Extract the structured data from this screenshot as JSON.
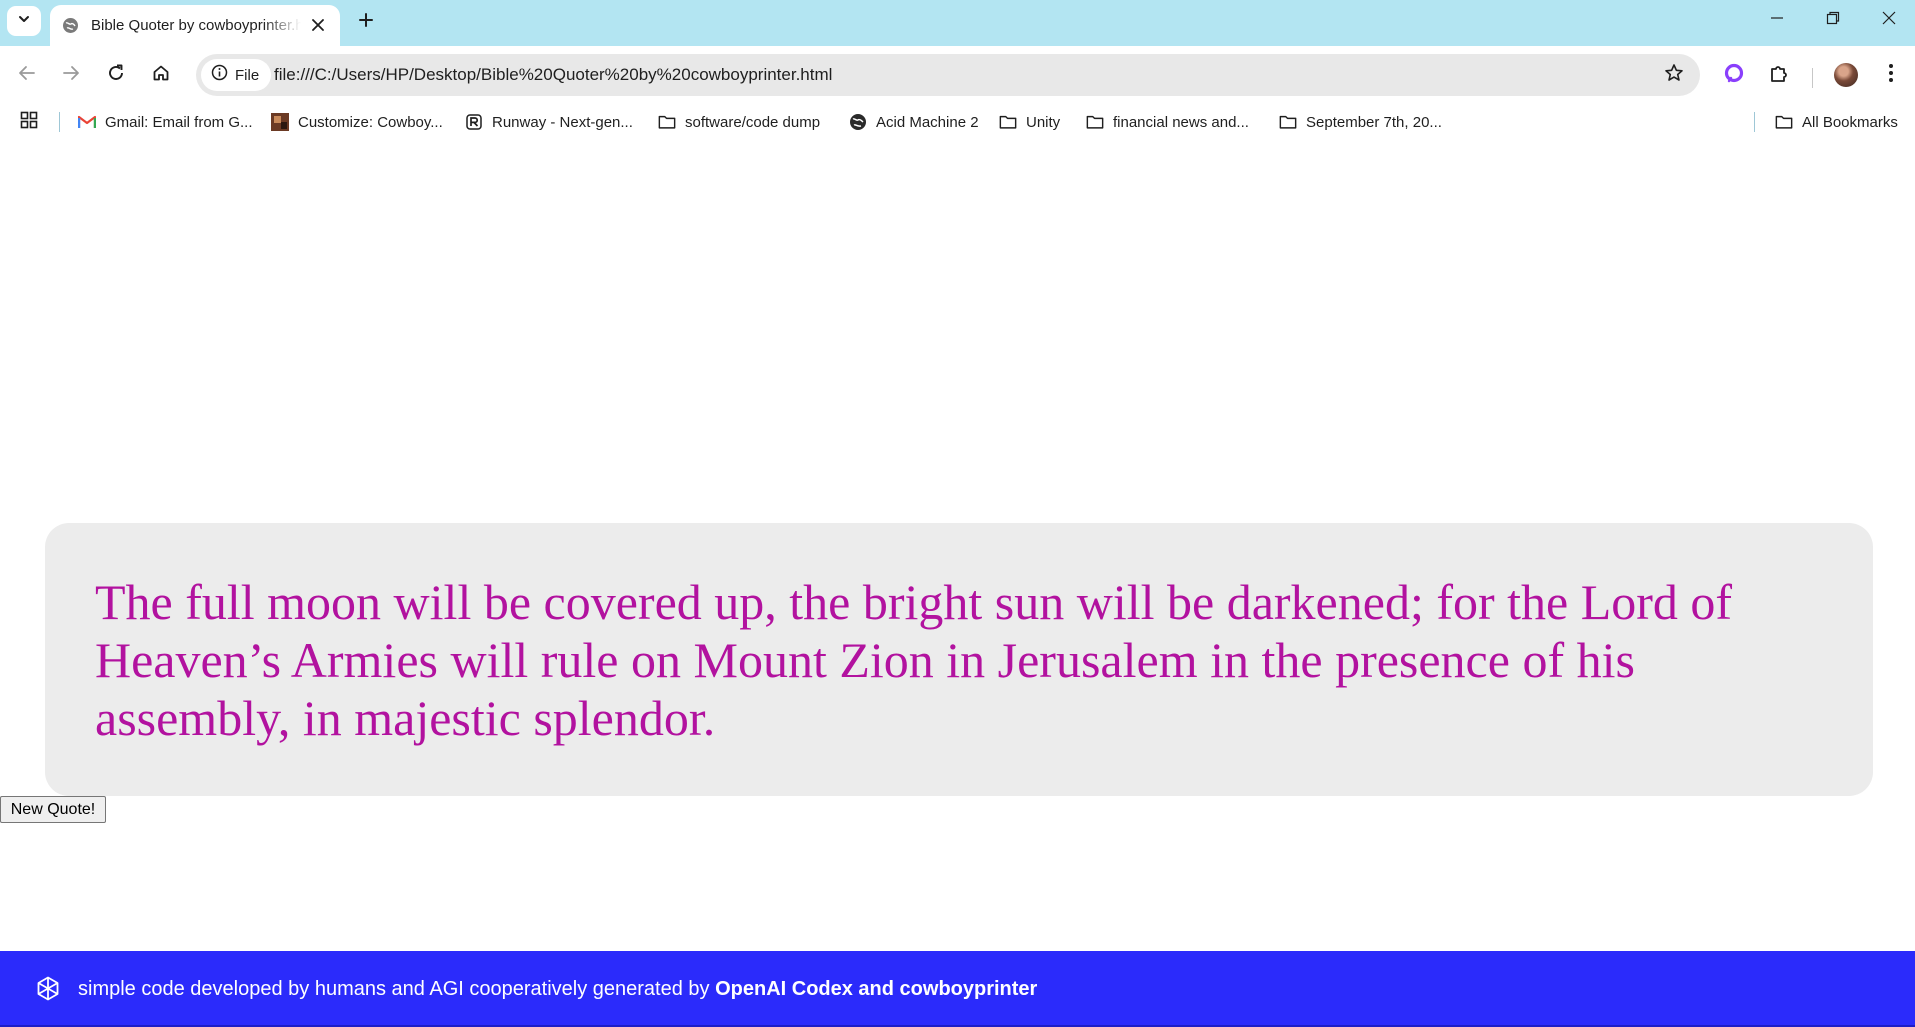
{
  "browser": {
    "tab": {
      "title": "Bible Quoter by cowboyprinter.html"
    },
    "omnibox": {
      "site_chip": "File",
      "url": "file:///C:/Users/HP/Desktop/Bible%20Quoter%20by%20cowboyprinter.html"
    },
    "bookmarks": [
      {
        "label": "Gmail: Email from G...",
        "icon": "gmail-icon"
      },
      {
        "label": "Customize: Cowboy...",
        "icon": "site-thumbnail-icon"
      },
      {
        "label": "Runway - Next-gen...",
        "icon": "runway-icon"
      },
      {
        "label": "software/code dump",
        "icon": "folder-icon"
      },
      {
        "label": "Acid Machine 2",
        "icon": "globe-icon"
      },
      {
        "label": "Unity",
        "icon": "folder-icon"
      },
      {
        "label": "financial news and...",
        "icon": "folder-icon"
      },
      {
        "label": "September 7th, 20...",
        "icon": "folder-icon"
      }
    ],
    "all_bookmarks": "All Bookmarks",
    "colors": {
      "tabstrip": "#b3e5f2",
      "omnibox": "#e8e8e8"
    }
  },
  "page": {
    "quote": "The full moon will be covered up, the bright sun will be darkened; for the Lord of Heaven’s Armies will rule on Mount Zion in Jerusalem in the presence of his assembly, in majestic splendor.",
    "button_label": "New Quote!",
    "footer": {
      "text_prefix": "simple code developed by humans and AGI cooperatively generated by ",
      "text_strong": "OpenAI Codex and cowboyprinter",
      "logo_icon": "openai-logo-icon"
    },
    "colors": {
      "quote_text": "#b2129f",
      "quote_box": "#ececec",
      "footer_bg": "#2b2bfb",
      "footer_text": "#ffffff"
    }
  }
}
